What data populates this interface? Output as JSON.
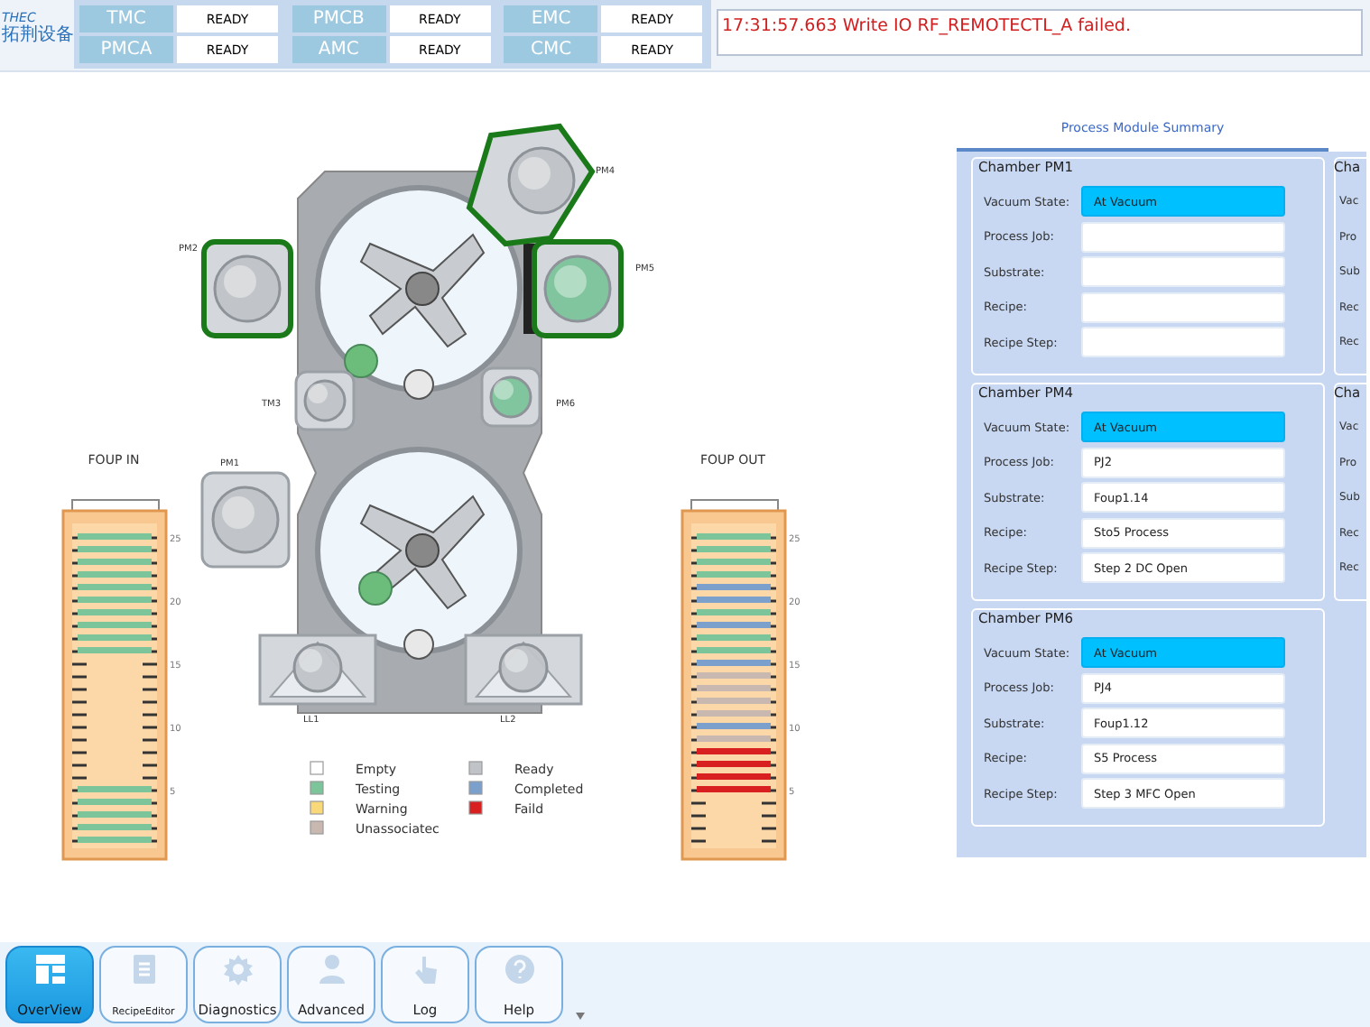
{
  "header": {
    "logo": {
      "latin": "THEC",
      "chinese": "拓荆设备"
    },
    "modules": [
      {
        "name": "TMC",
        "status": "READY"
      },
      {
        "name": "PMCB",
        "status": "READY"
      },
      {
        "name": "EMC",
        "status": "READY"
      },
      {
        "name": "PMCA",
        "status": "READY"
      },
      {
        "name": "AMC",
        "status": "READY"
      },
      {
        "name": "CMC",
        "status": "READY"
      }
    ],
    "message": "17:31:57.663 Write IO RF_REMOTECTL_A failed."
  },
  "tool": {
    "chambers": [
      {
        "label": "PM4",
        "highlighted": true,
        "kind": "ready"
      },
      {
        "label": "PM5",
        "highlighted": true,
        "kind": "testing"
      },
      {
        "label": "PM2",
        "highlighted": true,
        "kind": "ready"
      },
      {
        "label": "TM3",
        "highlighted": false,
        "kind": "ready"
      },
      {
        "label": "PM6",
        "highlighted": false,
        "kind": "testing"
      },
      {
        "label": "PM1",
        "highlighted": false,
        "kind": "ready"
      },
      {
        "label": "LL1",
        "highlighted": false,
        "kind": "ready"
      },
      {
        "label": "LL2",
        "highlighted": false,
        "kind": "ready"
      }
    ],
    "foups": [
      {
        "title": "FOUP IN",
        "ticks": [
          "25",
          "20",
          "15",
          "10",
          "5"
        ],
        "slots": [
          {
            "kind": "testing"
          },
          {
            "kind": "testing"
          },
          {
            "kind": "testing"
          },
          {
            "kind": "testing"
          },
          {
            "kind": "testing"
          },
          {
            "kind": "testing"
          },
          {
            "kind": "testing"
          },
          {
            "kind": "testing"
          },
          {
            "kind": "testing"
          },
          {
            "kind": "testing"
          },
          {
            "kind": "empty"
          },
          {
            "kind": "empty"
          },
          {
            "kind": "empty"
          },
          {
            "kind": "empty"
          },
          {
            "kind": "empty"
          },
          {
            "kind": "empty"
          },
          {
            "kind": "empty"
          },
          {
            "kind": "empty"
          },
          {
            "kind": "empty"
          },
          {
            "kind": "empty"
          },
          {
            "kind": "testing"
          },
          {
            "kind": "testing"
          },
          {
            "kind": "testing"
          },
          {
            "kind": "testing"
          },
          {
            "kind": "testing"
          }
        ]
      },
      {
        "title": "FOUP OUT",
        "ticks": [
          "25",
          "20",
          "15",
          "10",
          "5"
        ],
        "slots": [
          {
            "kind": "testing"
          },
          {
            "kind": "testing"
          },
          {
            "kind": "testing"
          },
          {
            "kind": "testing"
          },
          {
            "kind": "completed"
          },
          {
            "kind": "completed"
          },
          {
            "kind": "testing"
          },
          {
            "kind": "completed"
          },
          {
            "kind": "testing"
          },
          {
            "kind": "testing"
          },
          {
            "kind": "completed"
          },
          {
            "kind": "unassociated"
          },
          {
            "kind": "unassociated"
          },
          {
            "kind": "unassociated"
          },
          {
            "kind": "unassociated"
          },
          {
            "kind": "completed"
          },
          {
            "kind": "unassociated"
          },
          {
            "kind": "failed"
          },
          {
            "kind": "failed"
          },
          {
            "kind": "failed"
          },
          {
            "kind": "failed"
          },
          {
            "kind": "empty"
          },
          {
            "kind": "empty"
          },
          {
            "kind": "empty"
          },
          {
            "kind": "empty"
          }
        ]
      }
    ],
    "legend": [
      {
        "label": "Empty",
        "color": "#ffffff"
      },
      {
        "label": "Testing",
        "color": "#7cc49a"
      },
      {
        "label": "Warning",
        "color": "#f8d878"
      },
      {
        "label": "Unassociatec",
        "color": "#c8b8b0"
      },
      {
        "label": "Ready",
        "color": "#c0c4c8"
      },
      {
        "label": "Completed",
        "color": "#7ca0cc"
      },
      {
        "label": "Faild",
        "color": "#d82020"
      }
    ]
  },
  "summary": {
    "tab": "Process Module Summary",
    "cards": [
      {
        "kind": "full",
        "title": "Chamber PM1",
        "fields": [
          {
            "label": "Vacuum State:",
            "value": "At Vacuum",
            "highlighted": true
          },
          {
            "label": "Process Job:",
            "highlighted": false
          },
          {
            "label": "Substrate:",
            "highlighted": false
          },
          {
            "label": "Recipe:",
            "highlighted": false
          },
          {
            "label": "Recipe Step:",
            "highlighted": false
          }
        ]
      },
      {
        "kind": "clipped",
        "title": "Cha",
        "fields": [
          {
            "label": "Vac"
          },
          {
            "label": "Pro"
          },
          {
            "label": "Sub"
          },
          {
            "label": "Rec"
          },
          {
            "label": "Rec"
          }
        ]
      },
      {
        "kind": "full",
        "title": "Chamber PM4",
        "fields": [
          {
            "label": "Vacuum State:",
            "value": "At Vacuum",
            "highlighted": true
          },
          {
            "label": "Process Job:",
            "value": "PJ2",
            "highlighted": false
          },
          {
            "label": "Substrate:",
            "value": "Foup1.14",
            "highlighted": false
          },
          {
            "label": "Recipe:",
            "value": "Sto5 Process",
            "highlighted": false
          },
          {
            "label": "Recipe Step:",
            "value": "Step 2 DC Open",
            "highlighted": false
          }
        ]
      },
      {
        "kind": "clipped",
        "title": "Cha",
        "fields": [
          {
            "label": "Vac"
          },
          {
            "label": "Pro"
          },
          {
            "label": "Sub"
          },
          {
            "label": "Rec"
          },
          {
            "label": "Rec"
          }
        ]
      },
      {
        "kind": "full",
        "title": "Chamber PM6",
        "fields": [
          {
            "label": "Vacuum State:",
            "value": "At Vacuum",
            "highlighted": true
          },
          {
            "label": "Process Job:",
            "value": "PJ4",
            "highlighted": false
          },
          {
            "label": "Substrate:",
            "value": "Foup1.12",
            "highlighted": false
          },
          {
            "label": "Recipe:",
            "value": "S5 Process",
            "highlighted": false
          },
          {
            "label": "Recipe Step:",
            "value": "Step 3 MFC Open",
            "highlighted": false
          }
        ]
      }
    ]
  },
  "nav": [
    {
      "label": "OverView",
      "selected": true
    },
    {
      "label": "RecipeEditor",
      "selected": false
    },
    {
      "label": "Diagnostics",
      "selected": false
    },
    {
      "label": "Advanced",
      "selected": false
    },
    {
      "label": "Log",
      "selected": false
    },
    {
      "label": "Help",
      "selected": false
    }
  ]
}
